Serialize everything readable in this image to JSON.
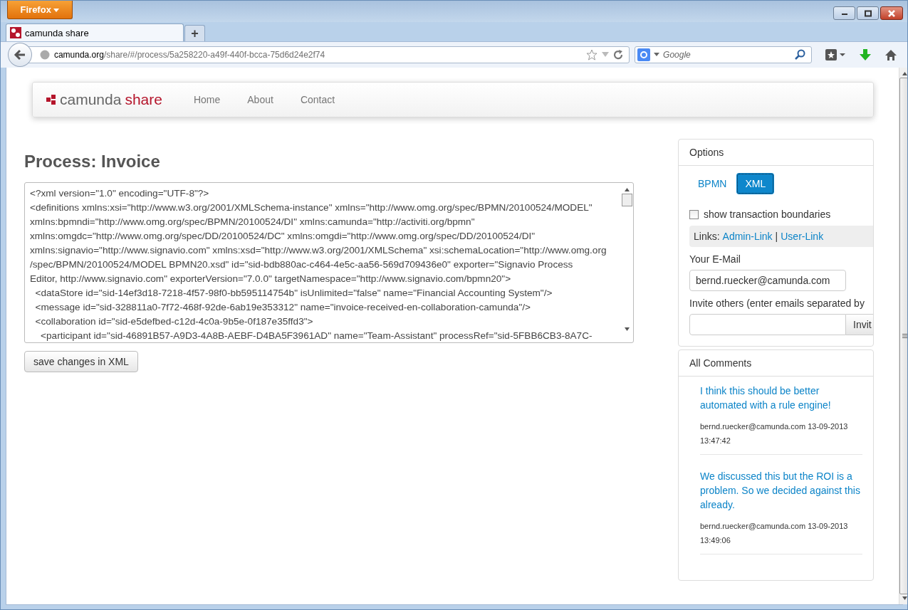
{
  "browser": {
    "menu_button": "Firefox",
    "tabs": [
      {
        "title": "camunda share",
        "selected": true
      }
    ],
    "new_tab": "+",
    "url_host": "camunda.org",
    "url_path": "/share/#/process/5a258220-a49f-440f-bcca-75d6d24e2f74",
    "search_placeholder": "Google"
  },
  "navbar": {
    "brand_name": "camunda",
    "brand_product": "share",
    "links": [
      {
        "label": "Home"
      },
      {
        "label": "About"
      },
      {
        "label": "Contact"
      }
    ]
  },
  "page": {
    "title": "Process: Invoice",
    "xml_lines": [
      "<?xml version=\"1.0\" encoding=\"UTF-8\"?>",
      "<definitions xmlns:xsi=\"http://www.w3.org/2001/XMLSchema-instance\" xmlns=\"http://www.omg.org/spec/BPMN/20100524/MODEL\"",
      "xmlns:bpmndi=\"http://www.omg.org/spec/BPMN/20100524/DI\" xmlns:camunda=\"http://activiti.org/bpmn\"",
      "xmlns:omgdc=\"http://www.omg.org/spec/DD/20100524/DC\" xmlns:omgdi=\"http://www.omg.org/spec/DD/20100524/DI\"",
      "xmlns:signavio=\"http://www.signavio.com\" xmlns:xsd=\"http://www.w3.org/2001/XMLSchema\" xsi:schemaLocation=\"http://www.omg.org",
      "/spec/BPMN/20100524/MODEL BPMN20.xsd\" id=\"sid-bdb880ac-c464-4e5c-aa56-569d709436e0\" exporter=\"Signavio Process",
      "Editor, http://www.signavio.com\" exporterVersion=\"7.0.0\" targetNamespace=\"http://www.signavio.com/bpmn20\">",
      "  <dataStore id=\"sid-14ef3d18-7218-4f57-98f0-bb595114754b\" isUnlimited=\"false\" name=\"Financial Accounting System\"/>",
      "  <message id=\"sid-328811a0-7f72-468f-92de-6ab19e353312\" name=\"invoice-received-en-collaboration-camunda\"/>",
      "  <collaboration id=\"sid-e5defbed-c12d-4c0a-9b5e-0f187e35ffd3\">",
      "    <participant id=\"sid-46891B57-A9D3-4A8B-AEBF-D4BA5F3961AD\" name=\"Team-Assistant\" processRef=\"sid-5FBB6CB3-8A7C-"
    ],
    "save_button": "save changes in XML"
  },
  "options": {
    "title": "Options",
    "views": [
      {
        "label": "BPMN",
        "selected": false
      },
      {
        "label": "XML",
        "selected": true
      }
    ],
    "transaction_checkbox": {
      "label": "show transaction boundaries",
      "checked": false
    },
    "links_prefix": "Links:",
    "links": [
      {
        "label": "Admin-Link"
      },
      {
        "label": "User-Link"
      }
    ],
    "links_separator": "|",
    "email_label": "Your E-Mail",
    "email_value": "bernd.ruecker@camunda.com",
    "invite_label": "Invite others (enter emails separated by",
    "invite_button": "Invit"
  },
  "comments": {
    "title": "All Comments",
    "items": [
      {
        "text": "I think this should be better automated with a rule engine!",
        "meta": "bernd.ruecker@camunda.com 13-09-2013 13:47:42"
      },
      {
        "text": "We discussed this but the ROI is a problem. So we decided against this already.",
        "meta": "bernd.ruecker@camunda.com 13-09-2013 13:49:06"
      }
    ]
  }
}
